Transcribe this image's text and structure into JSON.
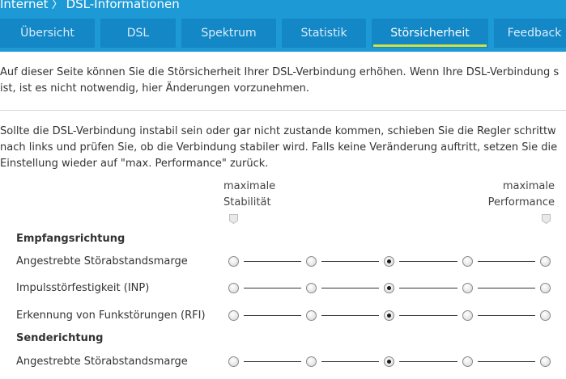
{
  "breadcrumb": {
    "root": "Internet",
    "separator": "〉",
    "current": "DSL-Informationen"
  },
  "tabs": [
    {
      "label": "Übersicht",
      "active": false
    },
    {
      "label": "DSL",
      "active": false
    },
    {
      "label": "Spektrum",
      "active": false
    },
    {
      "label": "Statistik",
      "active": false
    },
    {
      "label": "Störsicherheit",
      "active": true
    },
    {
      "label": "Feedback",
      "active": false
    }
  ],
  "intro": {
    "line1": "Auf dieser Seite können Sie die Störsicherheit Ihrer DSL-Verbindung erhöhen. Wenn Ihre DSL-Verbindung s",
    "line2": "ist, ist es nicht notwendig, hier Änderungen vorzunehmen."
  },
  "instructions": {
    "line1": "Sollte die DSL-Verbindung instabil sein oder gar nicht zustande kommen, schieben Sie die Regler schrittw",
    "line2": "nach links und prüfen Sie, ob die Verbindung stabiler wird. Falls keine Veränderung auftritt, setzen Sie die",
    "line3": "Einstellung wieder auf \"max. Performance\" zurück."
  },
  "scale": {
    "left_line1": "maximale",
    "left_line2": "Stabilität",
    "right_line1": "maximale",
    "right_line2": "Performance"
  },
  "sections": {
    "receive_title": "Empfangsrichtung",
    "send_title": "Senderichtung"
  },
  "rows": [
    {
      "label": "Angestrebte Störabstandsmarge",
      "selected_index": 2
    },
    {
      "label": "Impulsstörfestigkeit (INP)",
      "selected_index": 2
    },
    {
      "label": "Erkennung von Funkstörungen (RFI)",
      "selected_index": 2
    },
    {
      "label": "Angestrebte Störabstandsmarge",
      "selected_index": 2
    }
  ],
  "slider_steps": 5,
  "colors": {
    "header": "#1d9ad6",
    "tab": "#1487c6",
    "active_underline": "#cfe23f"
  }
}
